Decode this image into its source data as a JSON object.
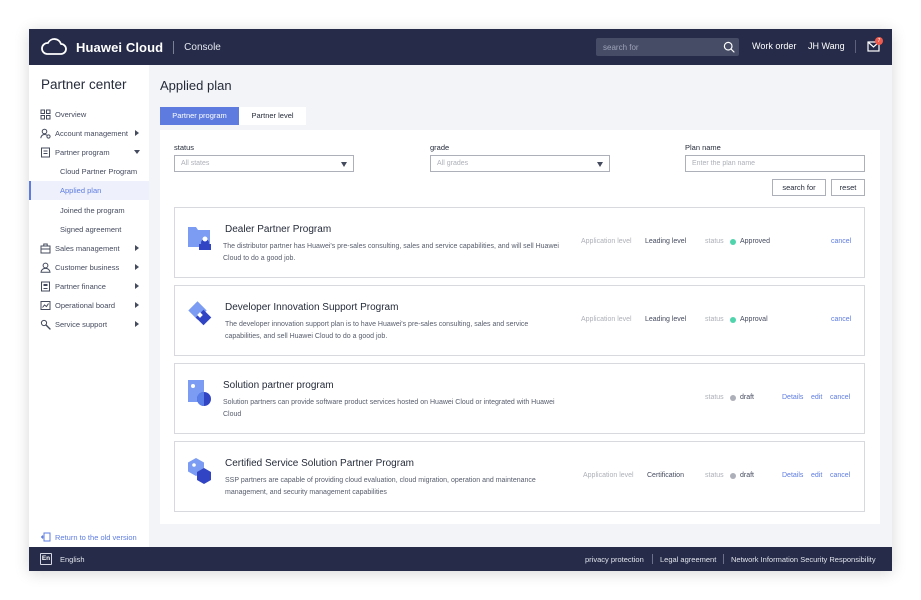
{
  "header": {
    "brand_name": "Huawei Cloud",
    "console_label": "Console",
    "search_placeholder": "search for",
    "work_order": "Work order",
    "user_name": "JH Wang",
    "mail_badge": "7"
  },
  "sidebar": {
    "title": "Partner center",
    "items": [
      {
        "label": "Overview",
        "icon": "grid-icon"
      },
      {
        "label": "Account management",
        "icon": "user-gear-icon"
      },
      {
        "label": "Partner program",
        "icon": "document-icon"
      },
      {
        "label": "Cloud Partner Program",
        "sub": true
      },
      {
        "label": "Applied plan",
        "sub": true,
        "active": true
      },
      {
        "label": "Joined the program",
        "sub": true
      },
      {
        "label": "Signed agreement",
        "sub": true
      },
      {
        "label": "Sales management",
        "icon": "briefcase-icon"
      },
      {
        "label": "Customer business",
        "icon": "customer-icon"
      },
      {
        "label": "Partner finance",
        "icon": "finance-icon"
      },
      {
        "label": "Operational board",
        "icon": "chart-icon"
      },
      {
        "label": "Service support",
        "icon": "wrench-icon"
      }
    ],
    "old_version": "Return to the old version"
  },
  "main": {
    "page_title": "Applied plan",
    "tabs": [
      {
        "label": "Partner program",
        "active": true
      },
      {
        "label": "Partner level",
        "active": false
      }
    ],
    "filters": {
      "status_label": "status",
      "status_placeholder": "All states",
      "grade_label": "grade",
      "grade_placeholder": "All grades",
      "plan_name_label": "Plan name",
      "plan_name_placeholder": "Enter the plan name",
      "search_button": "search for",
      "reset_button": "reset"
    },
    "plans": [
      {
        "title": "Dealer Partner Program",
        "description": "The distributor partner has Huawei's pre-sales consulting, sales and service capabilities, and will sell Huawei Cloud to do a good job.",
        "level_label": "Application level",
        "level_value": "Leading level",
        "status_label": "status",
        "status_value": "Approved",
        "actions": [
          "cancel"
        ]
      },
      {
        "title": "Developer Innovation Support Program",
        "description": "The developer innovation support plan is to have Huawei's pre-sales consulting, sales and service capabilities, and sell Huawei Cloud to do a good job.",
        "level_label": "Application level",
        "level_value": "Leading level",
        "status_label": "status",
        "status_value": "Approval",
        "actions": [
          "cancel"
        ]
      },
      {
        "title": "Solution partner program",
        "description": "Solution partners can provide software product services hosted on Huawei Cloud or integrated with Huawei Cloud",
        "status_label": "status",
        "status_value": "draft",
        "actions": [
          "Details",
          "edit",
          "cancel"
        ]
      },
      {
        "title": "Certified Service Solution Partner Program",
        "description": "SSP partners are capable of providing cloud evaluation, cloud migration, operation and maintenance management, and security management capabilities",
        "level_label": "Application level",
        "level_value": "Certification",
        "status_label": "status",
        "status_value": "draft",
        "actions": [
          "Details",
          "edit",
          "cancel"
        ]
      }
    ]
  },
  "footer": {
    "lang_badge": "En",
    "language": "English",
    "links": [
      "privacy protection",
      "Legal agreement",
      "Network Information Security Responsibility"
    ]
  },
  "colors": {
    "header_bg": "#252b48",
    "accent": "#5e7ce0",
    "status_approved": "#50d4ab",
    "status_draft": "#adb0b8",
    "icon_light": "#7b9cf2",
    "icon_dark": "#3044c4"
  }
}
